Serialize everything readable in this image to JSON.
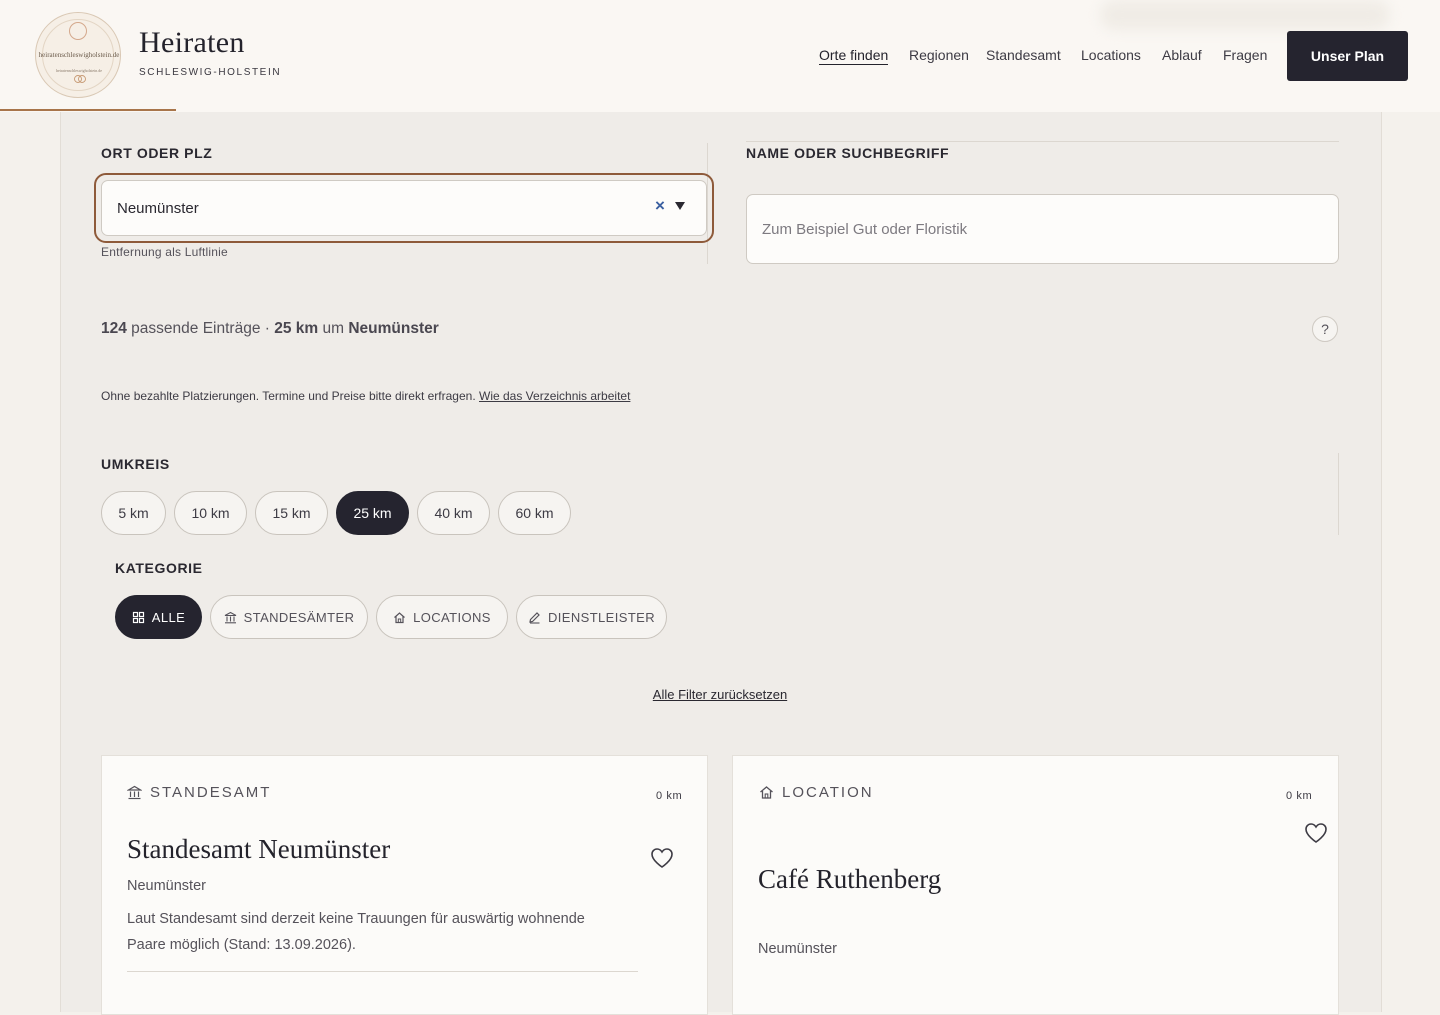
{
  "header": {
    "logo_text": "heiratenschleswigholstein.de",
    "logo_subtext": "heiratenschleswigholstein.de",
    "brand_title": "Heiraten",
    "brand_subtitle": "SCHLESWIG-HOLSTEIN",
    "nav": [
      {
        "label": "Orte finden",
        "active": true
      },
      {
        "label": "Regionen"
      },
      {
        "label": "Standesamt"
      },
      {
        "label": "Locations"
      },
      {
        "label": "Ablauf"
      },
      {
        "label": "Fragen"
      }
    ],
    "cta_label": "Unser Plan"
  },
  "filters": {
    "location_label": "ORT ODER PLZ",
    "location_value": "Neumünster",
    "clear_symbol": "×",
    "location_hint": "Entfernung als Luftlinie",
    "search_label": "NAME ODER SUCHBEGRIFF",
    "search_placeholder": "Zum Beispiel Gut oder Floristik",
    "search_value": ""
  },
  "results": {
    "count": "124",
    "count_text": " passende Einträge · ",
    "radius": "25 km",
    "around_text": " um ",
    "place": "Neumünster",
    "help_label": "?",
    "note": "Ohne bezahlte Platzierungen. Termine und Preise bitte direkt erfragen. ",
    "note_link": "Wie das Verzeichnis arbeitet"
  },
  "radius_filter": {
    "label": "UMKREIS",
    "options": [
      "5 km",
      "10 km",
      "15 km",
      "25 km",
      "40 km",
      "60 km"
    ],
    "selected": "25 km"
  },
  "category_filter": {
    "label": "KATEGORIE",
    "options": [
      {
        "label": "ALLE",
        "icon": "grid-icon",
        "active": true
      },
      {
        "label": "STANDESÄMTER",
        "icon": "building-icon"
      },
      {
        "label": "LOCATIONS",
        "icon": "house-icon"
      },
      {
        "label": "DIENSTLEISTER",
        "icon": "pencil-icon"
      }
    ]
  },
  "reset_label": "Alle Filter zurücksetzen",
  "cards": [
    {
      "type": "STANDESAMT",
      "icon": "building-icon",
      "distance": "0 km",
      "title": "Standesamt Neumünster",
      "city": "Neumünster",
      "description": "Laut Standesamt sind derzeit keine Trauungen für auswärtig wohnende Paare möglich (Stand: 13.09.2026)."
    },
    {
      "type": "LOCATION",
      "icon": "house-icon",
      "distance": "0 km",
      "title": "Café Ruthenberg",
      "city": "Neumünster"
    }
  ],
  "colors": {
    "background": "#f4f1ec",
    "panel": "#efece8",
    "dark": "#25242f",
    "accent": "#8e5a3a",
    "clear_icon": "#3a5fa0"
  }
}
